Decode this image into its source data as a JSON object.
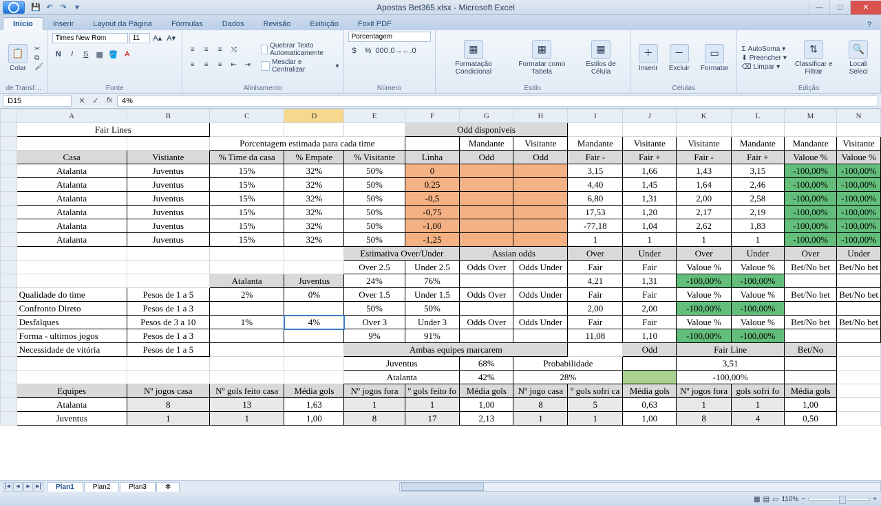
{
  "titlebar": {
    "title": "Apostas Bet365.xlsx - Microsoft Excel"
  },
  "tabs": {
    "inicio": "Início",
    "inserir": "Inserir",
    "layout": "Layout da Página",
    "formulas": "Fórmulas",
    "dados": "Dados",
    "revisao": "Revisão",
    "exibicao": "Exibição",
    "foxit": "Foxit PDF"
  },
  "ribbon": {
    "clipboard": {
      "colar": "Colar",
      "transf": "de Transf…",
      "label": ""
    },
    "font": {
      "name": "Times New Rom",
      "size": "11",
      "label": "Fonte"
    },
    "align": {
      "wrap": "Quebrar Texto Automaticamente",
      "merge": "Mesclar e Centralizar",
      "label": "Alinhamento"
    },
    "number": {
      "format": "Porcentagem",
      "label": "Número"
    },
    "style": {
      "cond": "Formatação Condicional",
      "table": "Formatar como Tabela",
      "cell": "Estilos de Célula",
      "label": "Estilo"
    },
    "cells": {
      "ins": "Inserir",
      "del": "Excluir",
      "fmt": "Formatar",
      "label": "Células"
    },
    "editing": {
      "sum": "AutoSoma",
      "fill": "Preencher",
      "clear": "Limpar",
      "sort": "Classificar e Filtrar",
      "find": "Locali Seleci",
      "label": "Edição"
    }
  },
  "formula": {
    "cell": "D15",
    "value": "4%"
  },
  "cols": [
    "A",
    "B",
    "C",
    "D",
    "E",
    "F",
    "G",
    "H",
    "I",
    "J",
    "K",
    "L",
    "M",
    "N"
  ],
  "headers": {
    "fair_lines": "Fair Lines",
    "porcentagem": "Porcentagem estimada para cada time",
    "odd_disp": "Odd disponíveis",
    "casa": "Casa",
    "visitante": "Vistiante",
    "pct_casa": "% Time da casa",
    "pct_emp": "% Empate",
    "pct_vis": "% Visitante",
    "linha": "Linha",
    "mandante_odd": "Odd",
    "visitante_odd": "Odd",
    "mandante": "Mandante",
    "visitante2": "Visitante",
    "fair_minus": "Fair -",
    "fair_plus": "Fair +",
    "valoue": "Valoue %"
  },
  "rows": [
    {
      "a": "Atalanta",
      "b": "Juventus",
      "c": "15%",
      "d": "32%",
      "e": "50%",
      "f": "0",
      "i": "3,15",
      "j": "1,66",
      "k": "1,43",
      "l": "3,15",
      "m": "-100,00%",
      "n": "-100,00%"
    },
    {
      "a": "Atalanta",
      "b": "Juventus",
      "c": "15%",
      "d": "32%",
      "e": "50%",
      "f": "0.25",
      "i": "4,40",
      "j": "1,45",
      "k": "1,64",
      "l": "2,46",
      "m": "-100,00%",
      "n": "-100,00%"
    },
    {
      "a": "Atalanta",
      "b": "Juventus",
      "c": "15%",
      "d": "32%",
      "e": "50%",
      "f": "-0,5",
      "i": "6,80",
      "j": "1,31",
      "k": "2,00",
      "l": "2,58",
      "m": "-100,00%",
      "n": "-100,00%"
    },
    {
      "a": "Atalanta",
      "b": "Juventus",
      "c": "15%",
      "d": "32%",
      "e": "50%",
      "f": "-0,75",
      "i": "17,53",
      "j": "1,20",
      "k": "2,17",
      "l": "2,19",
      "m": "-100,00%",
      "n": "-100,00%"
    },
    {
      "a": "Atalanta",
      "b": "Juventus",
      "c": "15%",
      "d": "32%",
      "e": "50%",
      "f": "-1,00",
      "i": "-77,18",
      "j": "1,04",
      "k": "2,62",
      "l": "1,83",
      "m": "-100,00%",
      "n": "-100,00%"
    },
    {
      "a": "Atalanta",
      "b": "Juventus",
      "c": "15%",
      "d": "32%",
      "e": "50%",
      "f": "-1,25",
      "i": "1",
      "j": "1",
      "k": "1",
      "l": "1",
      "m": "-100,00%",
      "n": "-100,00%"
    }
  ],
  "ou": {
    "est": "Estimativa Over/Under",
    "assian": "Assian odds",
    "over": "Over",
    "under": "Under",
    "fair": "Fair",
    "ov25": "Over 2.5",
    "un25": "Under 2.5",
    "oo": "Odds Over",
    "ou_": "Odds Under",
    "v24": "24%",
    "v76": "76%",
    "v421": "4,21",
    "v131": "1,31",
    "nv": "-100,00%",
    "bn": "Bet/No bet",
    "ov15": "Over 1.5",
    "un15": "Under 1.5",
    "v50": "50%",
    "v200": "2,00",
    "ov3": "Over 3",
    "un3": "Under 3",
    "v9": "9%",
    "v91": "91%",
    "v1108": "11,08",
    "v110": "1,10",
    "valoue": "Valoue %"
  },
  "bottom": {
    "quality": "Qualidade do time",
    "p15": "Pesos de 1 a 5",
    "v2": "2%",
    "v0": "0%",
    "confronto": "Confronto Direto",
    "p13": "Pesos de 1 a 3",
    "desfalques": "Desfalques",
    "p310": "Pesos de 3 a 10",
    "v1": "1%",
    "v4": "4%",
    "forma": "Forma - ultimos jogos",
    "necessidade": "Necessidade de vitória",
    "atalanta": "Atalanta",
    "juventus": "Juventus",
    "ambas": "Ambas equipes marcarem",
    "odd": "Odd",
    "fairline": "Fair Line",
    "betno": "Bet/No",
    "v68": "68%",
    "prob": "Probabilidade",
    "v351": "3,51",
    "v42": "42%",
    "v28": "28%",
    "nv": "-100,00%",
    "equipes": "Equipes",
    "njc": "Nº jogos casa",
    "ngfc": "Nº gols feito casa",
    "mg": "Média gols",
    "njf": "Nº jogos fora",
    "ngff": "º gols feito fo",
    "njc2": "Nº jogo casa",
    "gsc": "º gols sofri ca",
    "njf2": "Nº jogos fora",
    "gsf": "gols sofri fo"
  },
  "stats": [
    {
      "a": "Atalanta",
      "b": "8",
      "c": "13",
      "d": "1,63",
      "e": "1",
      "f": "1",
      "g": "1,00",
      "h": "8",
      "i": "5",
      "j": "0,63",
      "k": "1",
      "l": "1",
      "m": "1,00"
    },
    {
      "a": "Juventus",
      "b": "1",
      "c": "1",
      "d": "1,00",
      "e": "8",
      "f": "17",
      "g": "2,13",
      "h": "1",
      "i": "1",
      "j": "1,00",
      "k": "8",
      "l": "4",
      "m": "0,50"
    }
  ],
  "sheets": {
    "p1": "Plan1",
    "p2": "Plan2",
    "p3": "Plan3"
  },
  "status": {
    "zoom": "110%"
  }
}
